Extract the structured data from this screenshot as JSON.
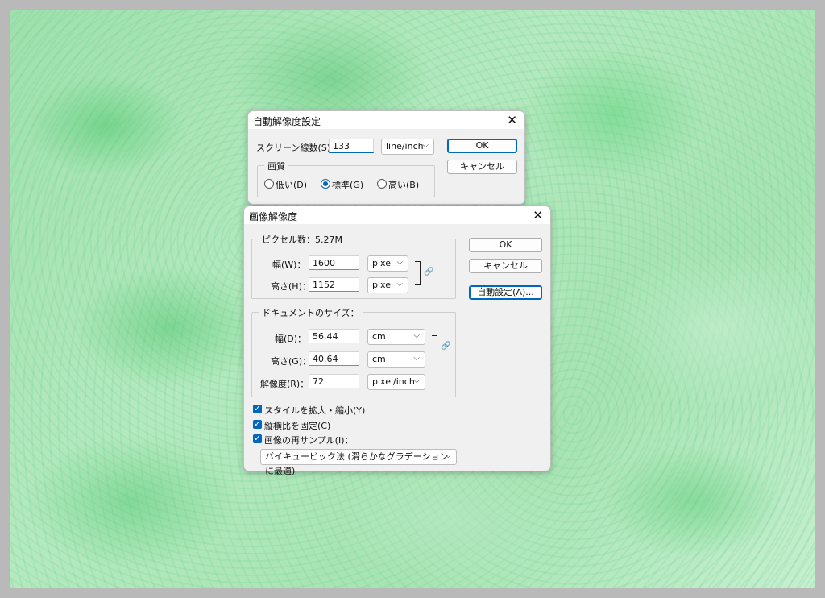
{
  "auto_dialog": {
    "title": "自動解像度設定",
    "screen_label": "スクリーン線数(S)：",
    "screen_value": "133",
    "screen_unit": "line/inch",
    "ok": "OK",
    "cancel": "キャンセル",
    "quality_legend": "画質",
    "quality_options": [
      {
        "label": "低い(D)",
        "selected": false
      },
      {
        "label": "標準(G)",
        "selected": true
      },
      {
        "label": "高い(B)",
        "selected": false
      }
    ]
  },
  "image_dialog": {
    "title": "画像解像度",
    "pixel_legend": "ピクセル数：5.27M",
    "width_label": "幅(W)：",
    "width_value": "1600",
    "width_unit": "pixel",
    "height_label": "高さ(H)：",
    "height_value": "1152",
    "height_unit": "pixel",
    "doc_legend": "ドキュメントのサイズ：",
    "doc_width_label": "幅(D)：",
    "doc_width_value": "56.44",
    "doc_width_unit": "cm",
    "doc_height_label": "高さ(G)：",
    "doc_height_value": "40.64",
    "doc_height_unit": "cm",
    "res_label": "解像度(R)：",
    "res_value": "72",
    "res_unit": "pixel/inch",
    "ok": "OK",
    "cancel": "キャンセル",
    "auto": "自動設定(A)...",
    "checks": [
      {
        "label": "スタイルを拡大・縮小(Y)",
        "checked": true
      },
      {
        "label": "縦横比を固定(C)",
        "checked": true
      },
      {
        "label": "画像の再サンプル(I)：",
        "checked": true
      }
    ],
    "resample_method": "バイキュービック法 (滑らかなグラデーションに最適)"
  },
  "icons": {
    "close": "✕",
    "chevron": "⌵",
    "check": "✓",
    "link": "🔗"
  }
}
